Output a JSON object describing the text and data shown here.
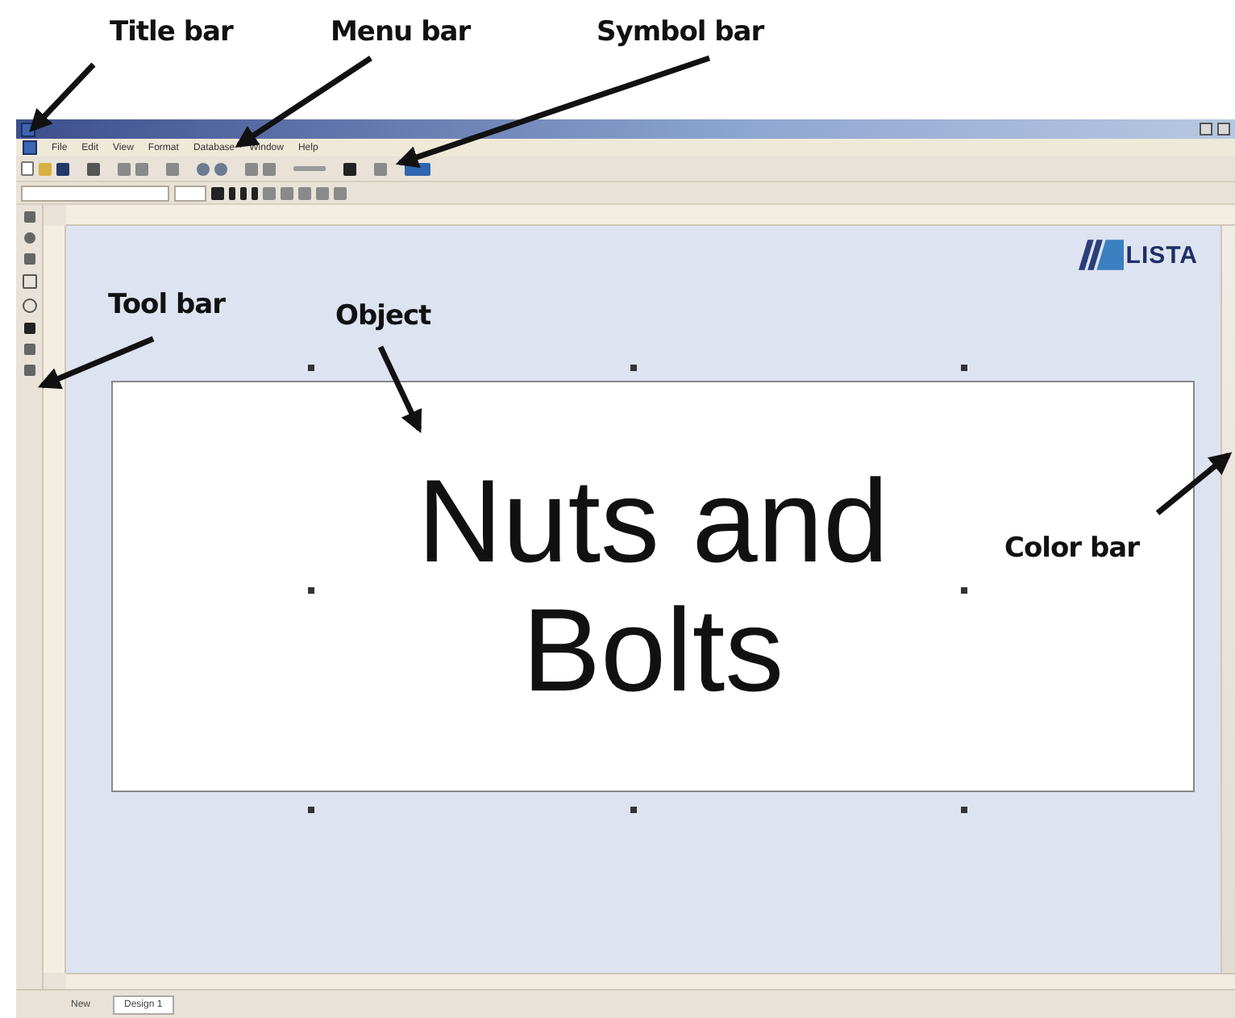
{
  "annotations": [
    {
      "label": "Title bar"
    },
    {
      "label": "Menu bar"
    },
    {
      "label": "Symbol bar"
    },
    {
      "label": "Tool bar"
    },
    {
      "label": "Object"
    },
    {
      "label": "Color bar"
    }
  ],
  "menu": [
    "File",
    "Edit",
    "View",
    "Format",
    "Database",
    "Window",
    "Help"
  ],
  "logo": {
    "text": "LISTA"
  },
  "label": {
    "lines": [
      "Nuts and",
      "Bolts"
    ]
  },
  "tabs": [
    {
      "label": "New",
      "selected": false
    },
    {
      "label": "Design 1",
      "selected": true
    }
  ]
}
